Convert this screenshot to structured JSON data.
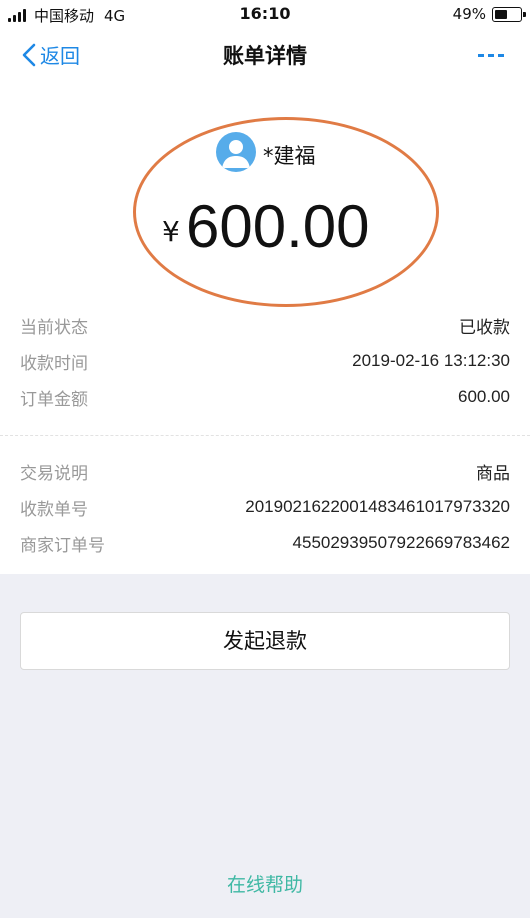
{
  "status_bar": {
    "carrier": "中国移动",
    "network": "4G",
    "time": "16:10",
    "battery_percent": "49%",
    "battery_level": 0.49
  },
  "nav": {
    "back_label": "返回",
    "title": "账单详情"
  },
  "payer": {
    "name": "*建福"
  },
  "amount": {
    "currency_symbol": "¥",
    "value": "600.00"
  },
  "details_group_1": [
    {
      "label": "当前状态",
      "value": "已收款"
    },
    {
      "label": "收款时间",
      "value": "2019-02-16 13:12:30"
    },
    {
      "label": "订单金额",
      "value": "600.00"
    }
  ],
  "details_group_2": [
    {
      "label": "交易说明",
      "value": "商品"
    },
    {
      "label": "收款单号",
      "value": "20190216220014834610179733​20"
    },
    {
      "label": "商家订单号",
      "value": "4550293950792266978​3462"
    }
  ],
  "actions": {
    "refund_label": "发起退款",
    "help_label": "在线帮助"
  },
  "colors": {
    "accent_blue": "#1e88e5",
    "help_green": "#3fb8a4",
    "highlight_orange": "#e07b45",
    "avatar_blue": "#56acea"
  }
}
